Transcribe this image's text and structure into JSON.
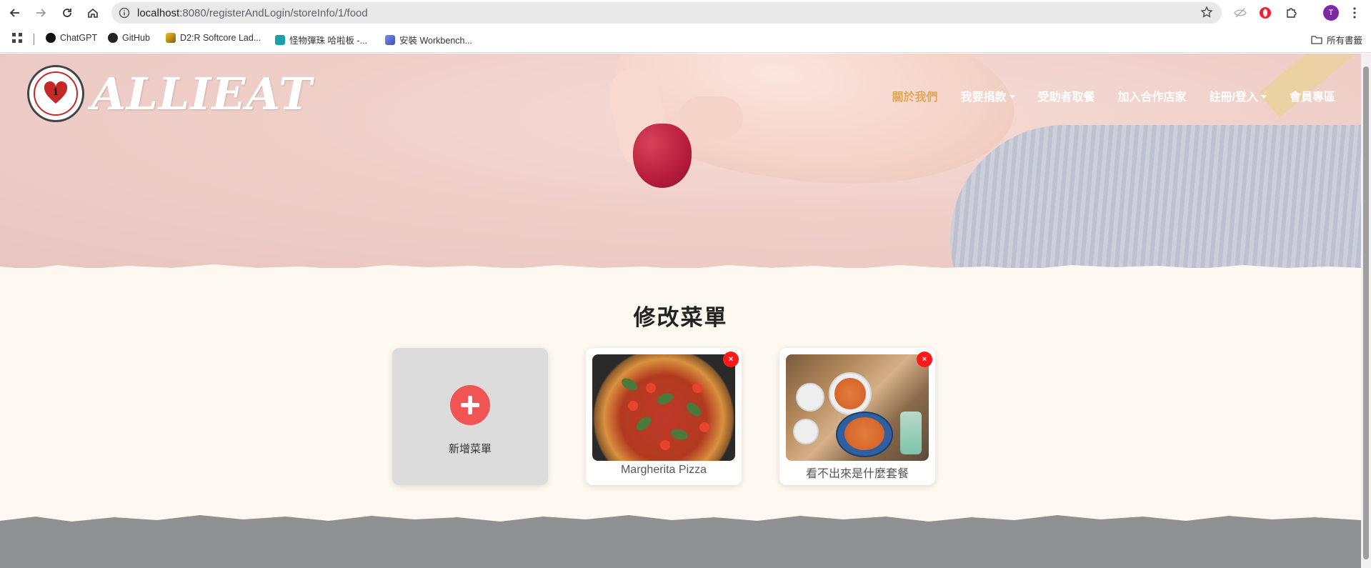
{
  "browser": {
    "url_host": "localhost",
    "url_rest": ":8080/registerAndLogin/storeInfo/1/food",
    "profile_initial": "T",
    "bookmarks": [
      {
        "label": "ChatGPT",
        "icon": "chatgpt-icon"
      },
      {
        "label": "GitHub",
        "icon": "github-icon"
      },
      {
        "label": "D2:R Softcore Lad...",
        "icon": "d2r-icon"
      },
      {
        "label": "怪物彈珠 哈啦板 -...",
        "icon": "monster-strike-icon"
      },
      {
        "label": "安裝 Workbench...",
        "icon": "workbench-icon"
      }
    ],
    "all_bookmarks_label": "所有書籤"
  },
  "site": {
    "logo_text": "ALLIEAT",
    "nav": [
      {
        "label": "關於我們",
        "active": true,
        "dropdown": false
      },
      {
        "label": "我要捐款",
        "active": false,
        "dropdown": true
      },
      {
        "label": "受助者取餐",
        "active": false,
        "dropdown": false
      },
      {
        "label": "加入合作店家",
        "active": false,
        "dropdown": false
      },
      {
        "label": "註冊/登入",
        "active": false,
        "dropdown": true
      },
      {
        "label": "會員專區",
        "active": false,
        "dropdown": false
      }
    ]
  },
  "main": {
    "title": "修改菜單",
    "add_label": "新增菜單",
    "delete_symbol": "×",
    "items": [
      {
        "name": "Margherita Pizza",
        "image": "pizza"
      },
      {
        "name": "看不出來是什麼套餐",
        "image": "meal"
      }
    ]
  },
  "colors": {
    "accent_red": "#f05454",
    "delete_red": "#ff1a1a",
    "nav_active": "#e0a85a",
    "page_bg": "#fdf8f0",
    "footer_gray": "#8e9091"
  }
}
